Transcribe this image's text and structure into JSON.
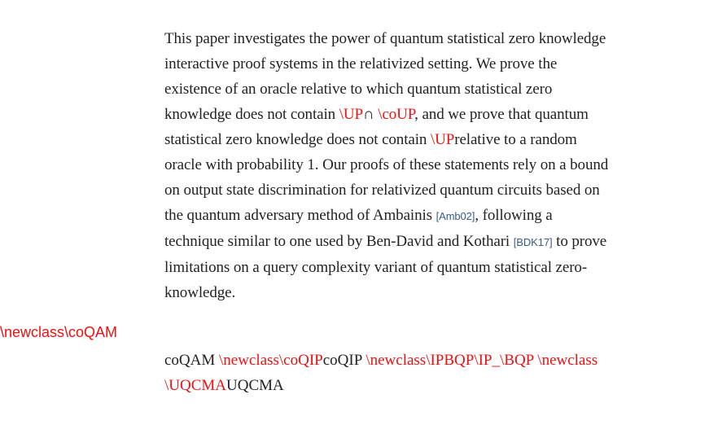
{
  "abstract": {
    "l1": "This paper investigates the power of quantum statistical zero knowledge",
    "l2": "interactive proof systems in the relativized setting. We prove the",
    "l3": "existence of an oracle relative to which quantum statistical zero",
    "l4a": "knowledge does not contain ",
    "l4_up": "\\UP",
    "l4_cap": "∩ ",
    "l4_coup": "\\coUP",
    "l4b": ", and we prove that quantum",
    "l5a": "statistical zero knowledge does not contain ",
    "l5_up": "\\UP",
    "l5b": "relative to a random",
    "l6": "oracle with probability 1. Our proofs of these statements rely on a bound",
    "l7": "on output state discrimination for relativized quantum circuits based on",
    "l8a": "the quantum adversary method of Ambainis ",
    "l8_cite": "[Amb02]",
    "l8b": ", following a",
    "l9a": "technique similar to one used by Ben-David and Kothari ",
    "l9_cite": "[BDK17]",
    "l9b": " to prove",
    "l10": "limitations on a query complexity variant of quantum statistical zero-",
    "l11": "knowledge."
  },
  "side_label": "\\newclass\\coQAM",
  "classes": {
    "t1": "coQAM ",
    "m1": "\\newclass\\coQIP",
    "t2": "coQIP ",
    "m2": "\\newclass\\IPBQP\\IP_\\BQP \\newclass",
    "m3": "\\UQCMA",
    "t3": "UQCMA"
  },
  "colors": {
    "macro": "#ee1111",
    "text": "#222222",
    "citation": "#3a5a8a"
  }
}
